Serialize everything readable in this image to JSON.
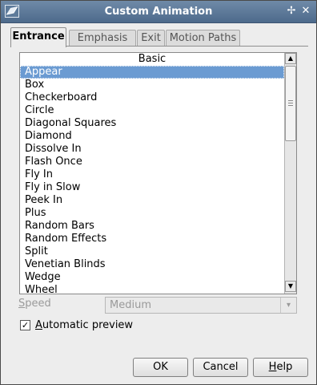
{
  "window": {
    "title": "Custom Animation",
    "pin_glyph": "✢",
    "close_glyph": "✕"
  },
  "tabs": [
    {
      "label": "Entrance",
      "active": true
    },
    {
      "label": "Emphasis",
      "active": false
    },
    {
      "label": "Exit",
      "active": false
    },
    {
      "label": "Motion Paths",
      "active": false
    }
  ],
  "effects_list": {
    "header": "Basic",
    "selected": "Appear",
    "items": [
      "Appear",
      "Box",
      "Checkerboard",
      "Circle",
      "Diagonal Squares",
      "Diamond",
      "Dissolve In",
      "Flash Once",
      "Fly In",
      "Fly in Slow",
      "Peek In",
      "Plus",
      "Random Bars",
      "Random Effects",
      "Split",
      "Venetian Blinds",
      "Wedge",
      "Wheel"
    ],
    "scroll_up_glyph": "▲",
    "scroll_down_glyph": "▼",
    "scroll_position": 0.0
  },
  "speed": {
    "label_first": "S",
    "label_rest": "peed",
    "value": "Medium",
    "arrow_glyph": "▾"
  },
  "automatic_preview": {
    "label_first": "A",
    "label_rest": "utomatic preview",
    "checked": true,
    "check_glyph": "✓"
  },
  "buttons": {
    "ok": "OK",
    "cancel": "Cancel",
    "help_first": "H",
    "help_rest": "elp"
  }
}
